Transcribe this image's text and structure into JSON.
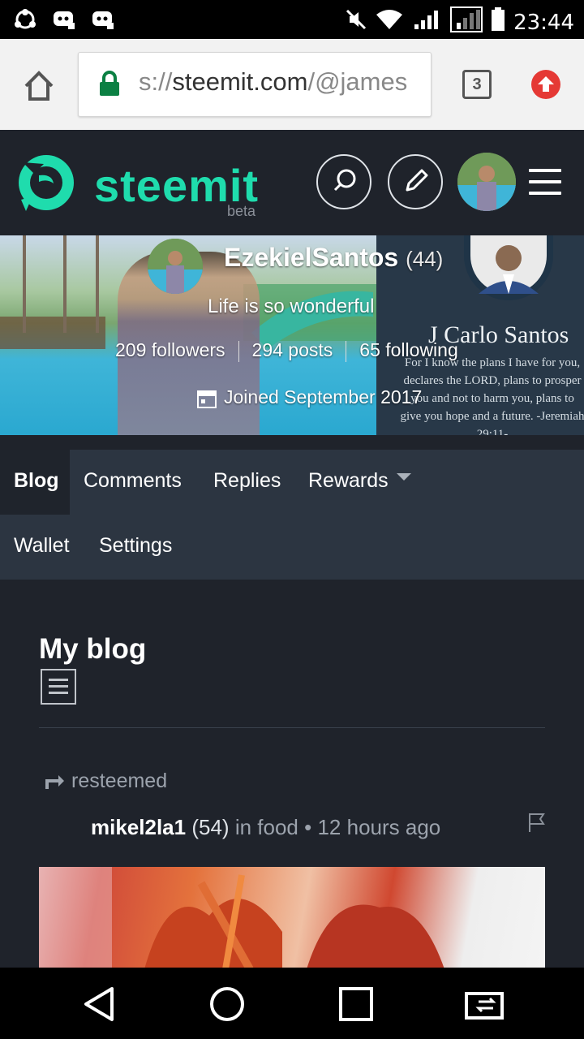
{
  "status_bar": {
    "time": "23:44"
  },
  "browser": {
    "url_scheme": "s://",
    "url_domain": "steemit.com",
    "url_path": "/@james",
    "tab_count": "3"
  },
  "header": {
    "logo": "steemit",
    "beta": "beta"
  },
  "profile": {
    "name": "EzekielSantos",
    "reputation": "(44)",
    "about": "Life is so wonderful",
    "followers": "209 followers",
    "posts": "294 posts",
    "following": "65 following",
    "joined": "Joined September 2017"
  },
  "cover": {
    "right_name": "J Carlo Santos",
    "verse": "For I know the plans I have for you, declares the LORD, plans to prosper you and not to harm you, plans to give you hope and a future. -Jeremiah 29:11-"
  },
  "nav": {
    "blog": "Blog",
    "comments": "Comments",
    "replies": "Replies",
    "rewards": "Rewards",
    "wallet": "Wallet",
    "settings": "Settings"
  },
  "content": {
    "section_title": "My blog",
    "resteemed": "resteemed",
    "post": {
      "author": "mikel2la1",
      "reputation": "(54)",
      "category": "in food",
      "separator": "•",
      "time": "12 hours ago"
    }
  },
  "colors": {
    "brand": "#1fdcad",
    "header_bg": "#1f232b",
    "nav_bg": "#2c3541"
  }
}
